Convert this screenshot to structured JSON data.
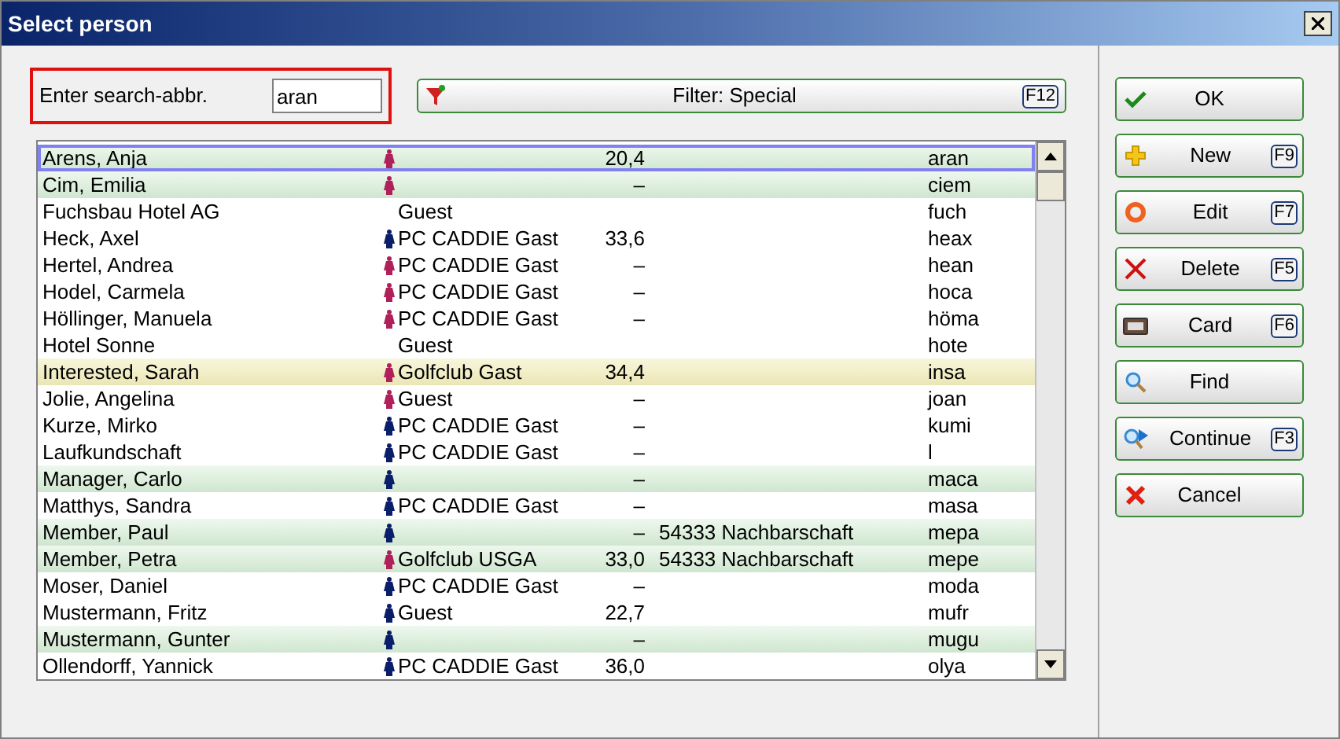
{
  "window": {
    "title": "Select person"
  },
  "search": {
    "label": "Enter search-abbr.",
    "value": "aran"
  },
  "filter_button": {
    "label": "Filter: Special",
    "shortcut": "F12"
  },
  "rows": [
    {
      "name": "Arens, Anja",
      "color": "#b0205a",
      "hcp": "20,4",
      "abbr": "aran",
      "kind": "member",
      "selected": true
    },
    {
      "name": "Cim, Emilia",
      "color": "#b0205a",
      "hcp": "–",
      "abbr": "ciem",
      "kind": "member",
      "selected": false
    },
    {
      "name": "Fuchsbau Hotel AG",
      "group": "Guest",
      "abbr": "fuch",
      "kind": "guest",
      "selected": false
    },
    {
      "name": "Heck, Axel",
      "color": "#0a1e6a",
      "group": "PC CADDIE Gast",
      "hcp": "33,6",
      "abbr": "heax",
      "kind": "guest",
      "selected": false
    },
    {
      "name": "Hertel, Andrea",
      "color": "#b0205a",
      "group": "PC CADDIE Gast",
      "hcp": "–",
      "abbr": "hean",
      "kind": "guest",
      "selected": false
    },
    {
      "name": "Hodel, Carmela",
      "color": "#b0205a",
      "group": "PC CADDIE Gast",
      "hcp": "–",
      "abbr": "hoca",
      "kind": "guest",
      "selected": false
    },
    {
      "name": "Höllinger, Manuela",
      "color": "#b0205a",
      "group": "PC CADDIE Gast",
      "hcp": "–",
      "abbr": "höma",
      "kind": "guest",
      "selected": false
    },
    {
      "name": "Hotel Sonne",
      "group": "Guest",
      "abbr": "hote",
      "kind": "guest",
      "selected": false
    },
    {
      "name": "Interested, Sarah",
      "color": "#b0205a",
      "group": "Golfclub Gast",
      "hcp": "34,4",
      "abbr": "insa",
      "kind": "prospect",
      "selected": false
    },
    {
      "name": "Jolie, Angelina",
      "color": "#b0205a",
      "group": "Guest",
      "hcp": "–",
      "abbr": "joan",
      "kind": "guest",
      "selected": false
    },
    {
      "name": "Kurze, Mirko",
      "color": "#0a1e6a",
      "group": "PC CADDIE Gast",
      "hcp": "–",
      "abbr": "kumi",
      "kind": "guest",
      "selected": false
    },
    {
      "name": "Laufkundschaft",
      "color": "#0a1e6a",
      "group": "PC CADDIE Gast",
      "hcp": "–",
      "abbr": "l",
      "kind": "guest",
      "selected": false
    },
    {
      "name": "Manager, Carlo",
      "color": "#0a1e6a",
      "hcp": "–",
      "abbr": "maca",
      "kind": "member",
      "selected": false
    },
    {
      "name": "Matthys, Sandra",
      "color": "#0a1e6a",
      "group": "PC CADDIE Gast",
      "hcp": "–",
      "abbr": "masa",
      "kind": "guest",
      "selected": false
    },
    {
      "name": "Member, Paul",
      "color": "#0a1e6a",
      "hcp": "–",
      "address": "54333 Nachbarschaft",
      "abbr": "mepa",
      "kind": "member",
      "selected": false
    },
    {
      "name": "Member, Petra",
      "color": "#b0205a",
      "group": "Golfclub USGA",
      "hcp": "33,0",
      "address": "54333 Nachbarschaft",
      "abbr": "mepe",
      "kind": "member",
      "selected": false
    },
    {
      "name": "Moser, Daniel",
      "color": "#0a1e6a",
      "group": "PC CADDIE Gast",
      "hcp": "–",
      "abbr": "moda",
      "kind": "guest",
      "selected": false
    },
    {
      "name": "Mustermann, Fritz",
      "color": "#0a1e6a",
      "group": "Guest",
      "hcp": "22,7",
      "abbr": "mufr",
      "kind": "guest",
      "selected": false
    },
    {
      "name": "Mustermann, Gunter",
      "color": "#0a1e6a",
      "hcp": "–",
      "abbr": "mugu",
      "kind": "member",
      "selected": false
    },
    {
      "name": "Ollendorff, Yannick",
      "color": "#0a1e6a",
      "group": "PC CADDIE Gast",
      "hcp": "36,0",
      "abbr": "olya",
      "kind": "guest",
      "selected": false
    }
  ],
  "buttons": [
    {
      "label": "OK"
    },
    {
      "label": "New",
      "shortcut": "F9"
    },
    {
      "label": "Edit",
      "shortcut": "F7"
    },
    {
      "label": "Delete",
      "shortcut": "F5"
    },
    {
      "label": "Card",
      "shortcut": "F6"
    },
    {
      "label": "Find"
    },
    {
      "label": "Continue",
      "shortcut": "F3"
    },
    {
      "label": "Cancel"
    }
  ]
}
